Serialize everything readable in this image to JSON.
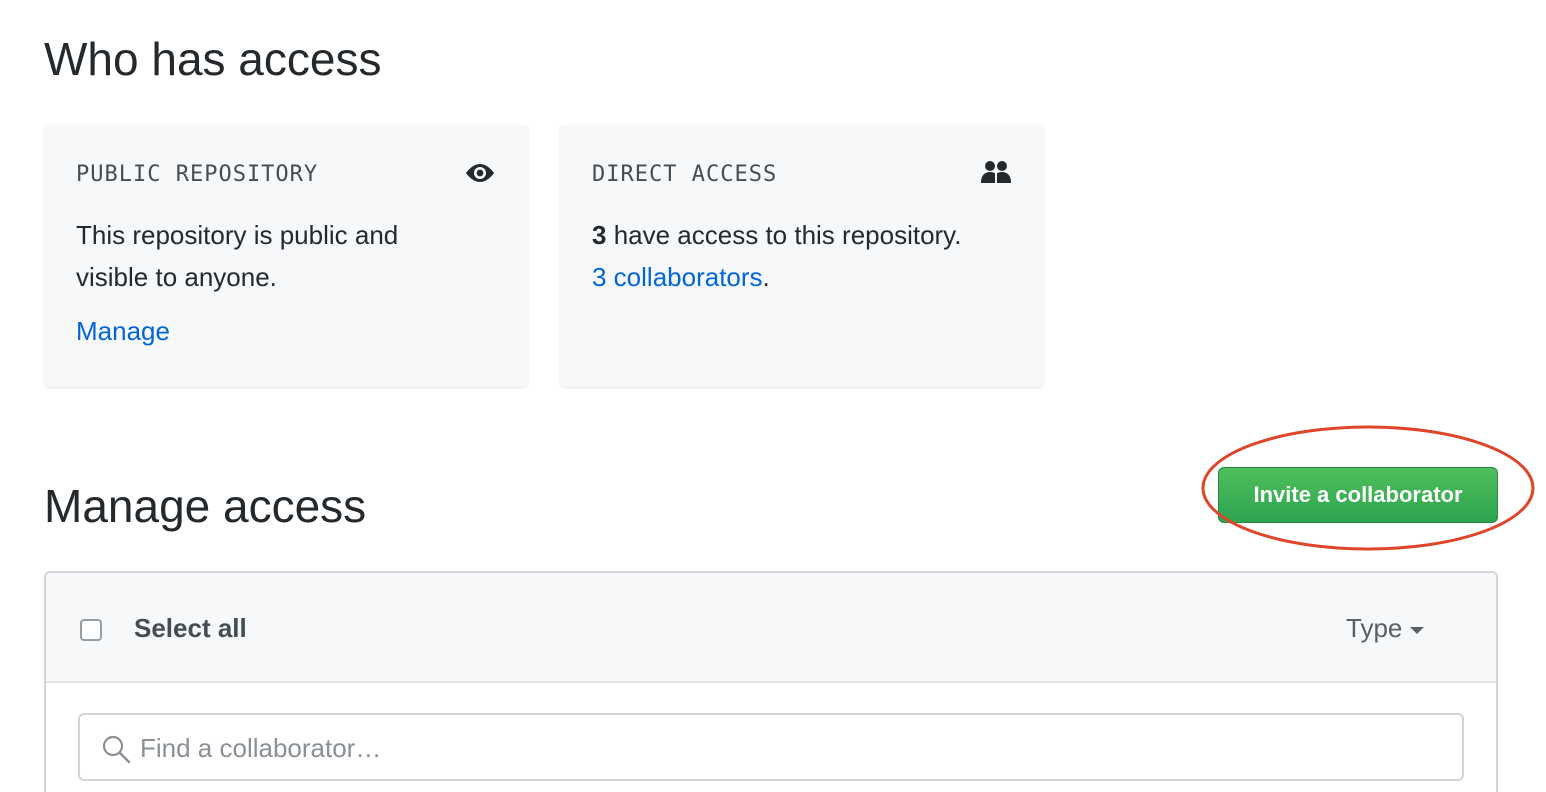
{
  "who_has_access": {
    "title": "Who has access",
    "public_card": {
      "heading": "PUBLIC REPOSITORY",
      "icon": "eye-icon",
      "text": "This repository is public and visible to anyone.",
      "link": "Manage"
    },
    "direct_card": {
      "heading": "DIRECT ACCESS",
      "icon": "people-icon",
      "count": "3",
      "count_text": " have access to this repository.",
      "collaborators_link": "3 collaborators",
      "period": "."
    }
  },
  "manage_access": {
    "title": "Manage access",
    "invite_button": "Invite a collaborator",
    "select_all": "Select all",
    "type_filter": "Type",
    "search_placeholder": "Find a collaborator…"
  },
  "colors": {
    "accent_link": "#0366d6",
    "primary_button": "#2ea44f",
    "highlight_ring": "#e0442b"
  }
}
